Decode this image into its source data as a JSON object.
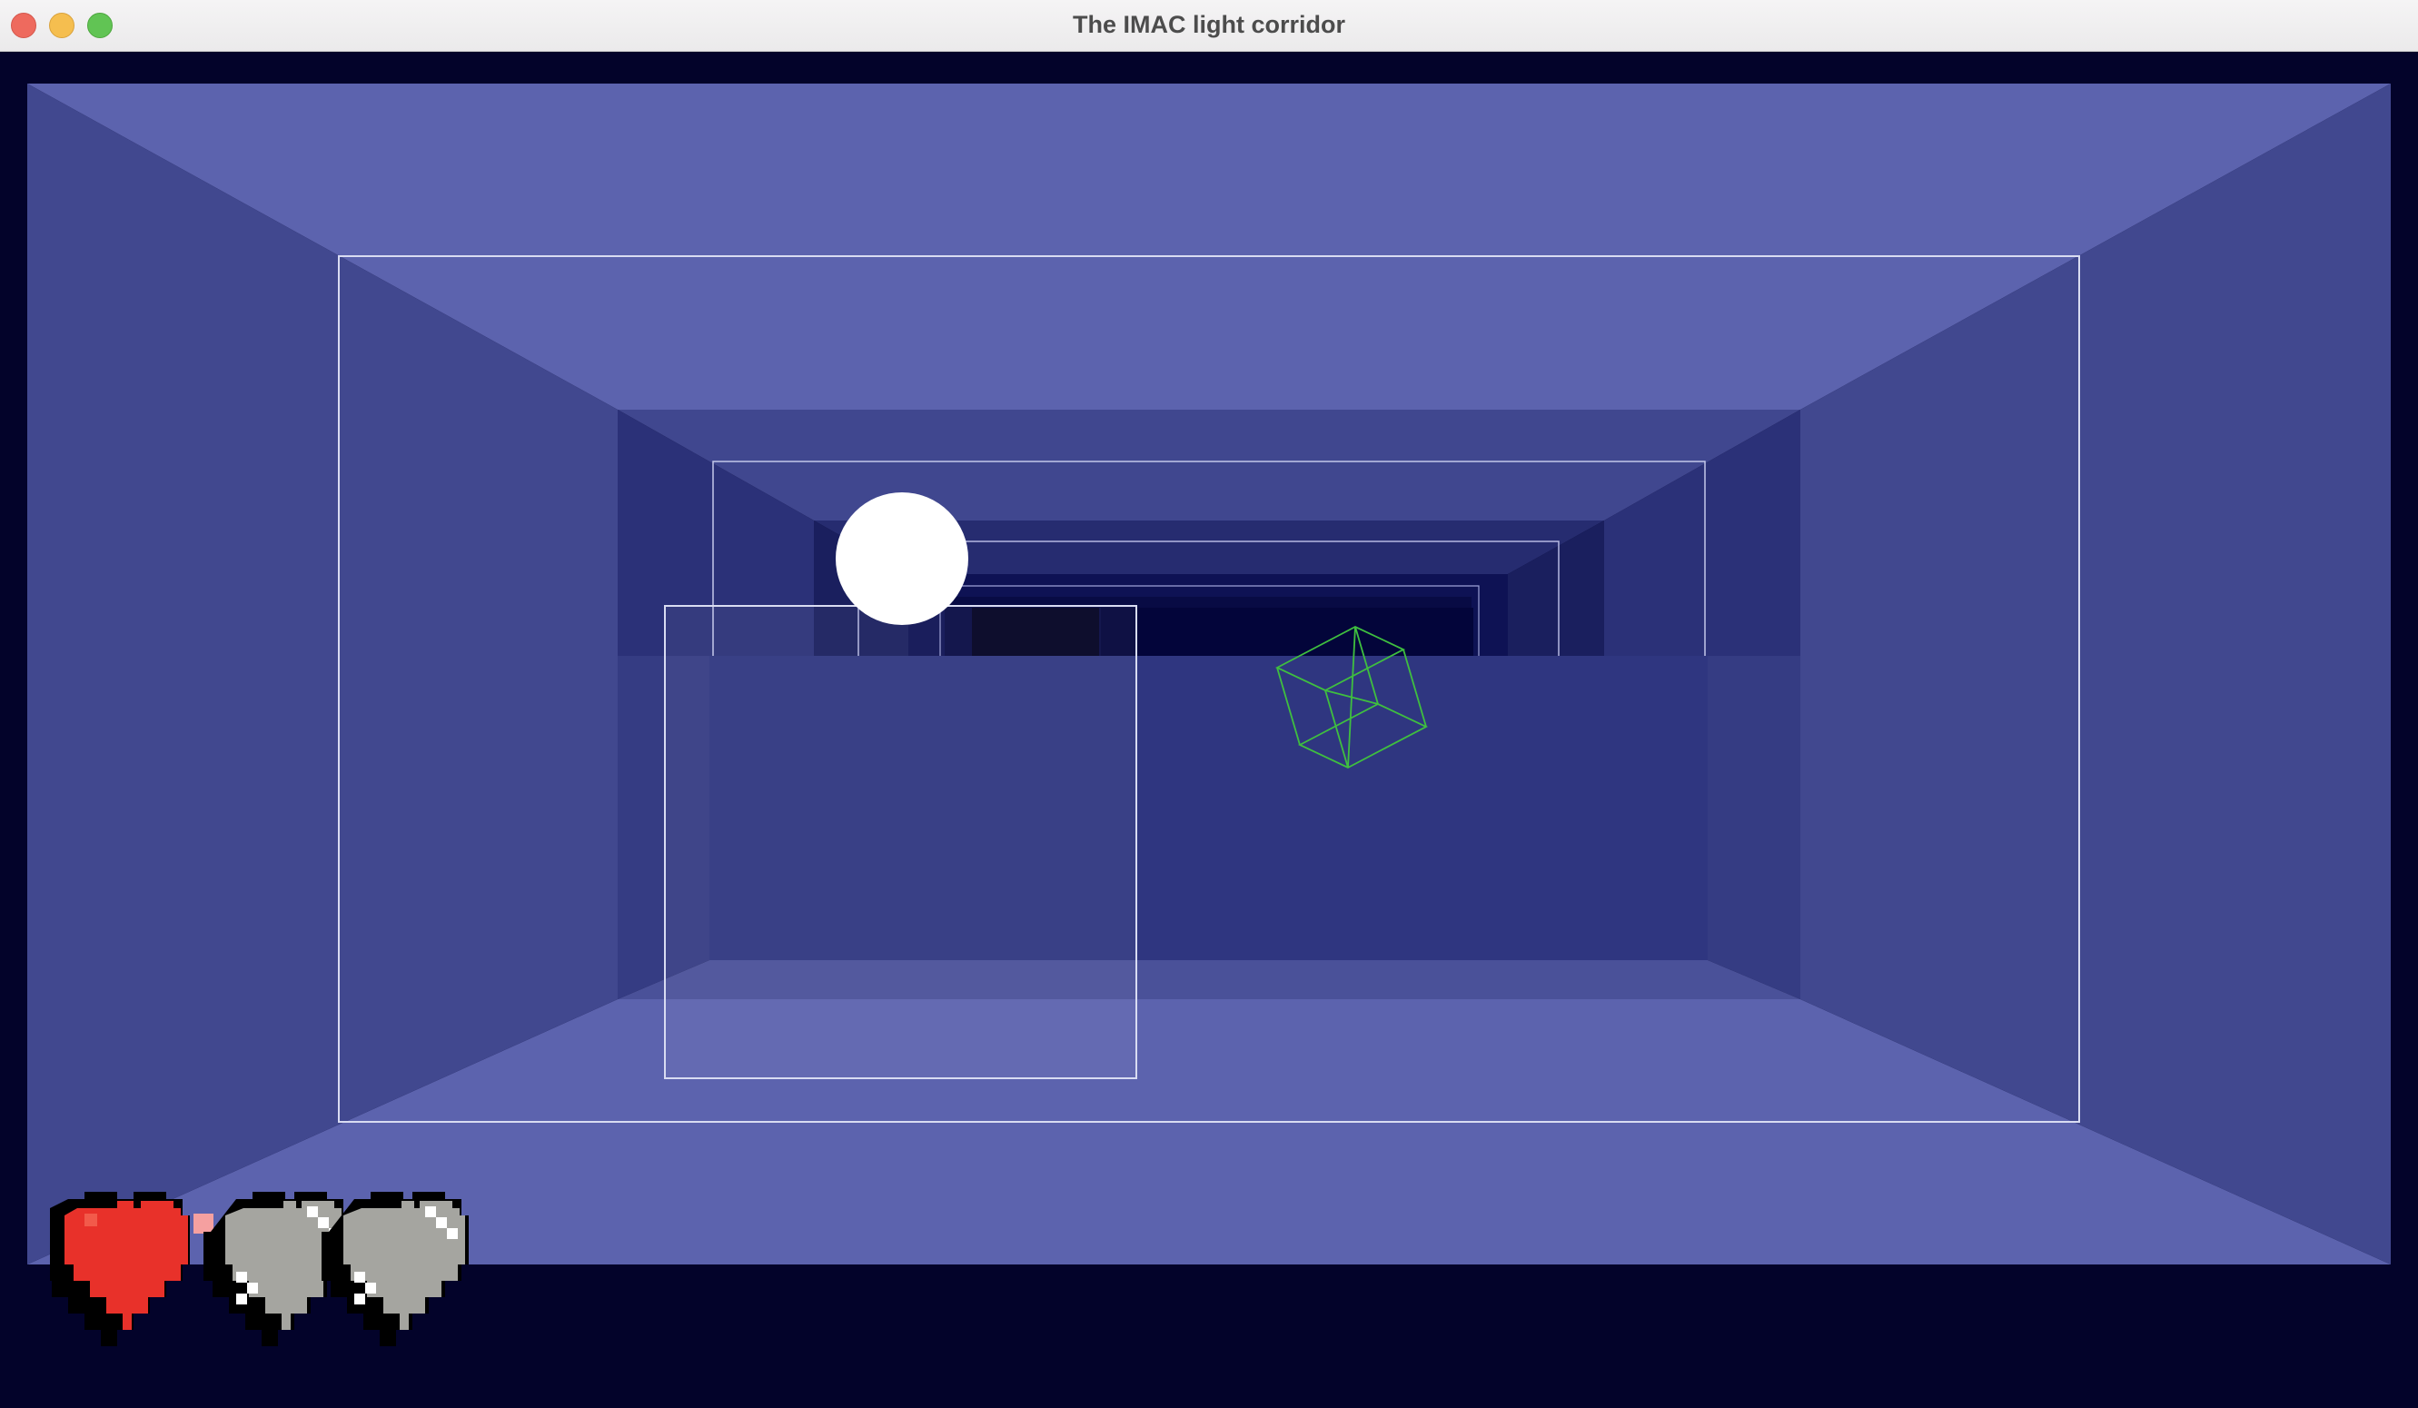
{
  "window": {
    "title": "The IMAC light corridor"
  },
  "colors": {
    "background": "#03032a",
    "ceiling": "#5c63ae",
    "floor": "#5c63ae",
    "side_wall": "#41488f",
    "far_wall": "#2f3680",
    "frame_line": "#d9dcf2",
    "ball": "#ffffff",
    "cube_wire": "#3fbf3f",
    "heart_full": "#e8312a",
    "heart_empty": "#a5a5a0"
  },
  "hud": {
    "lives_total": 3,
    "lives_remaining": 1,
    "hearts": [
      {
        "state": "full",
        "icon": "heart-full-icon"
      },
      {
        "state": "empty",
        "icon": "heart-empty-icon"
      },
      {
        "state": "empty",
        "icon": "heart-empty-icon"
      }
    ]
  },
  "scene": {
    "ball": {
      "icon": "ball"
    },
    "racket": {
      "icon": "racket-frame"
    },
    "bonus": {
      "icon": "wireframe-cube-icon"
    }
  }
}
